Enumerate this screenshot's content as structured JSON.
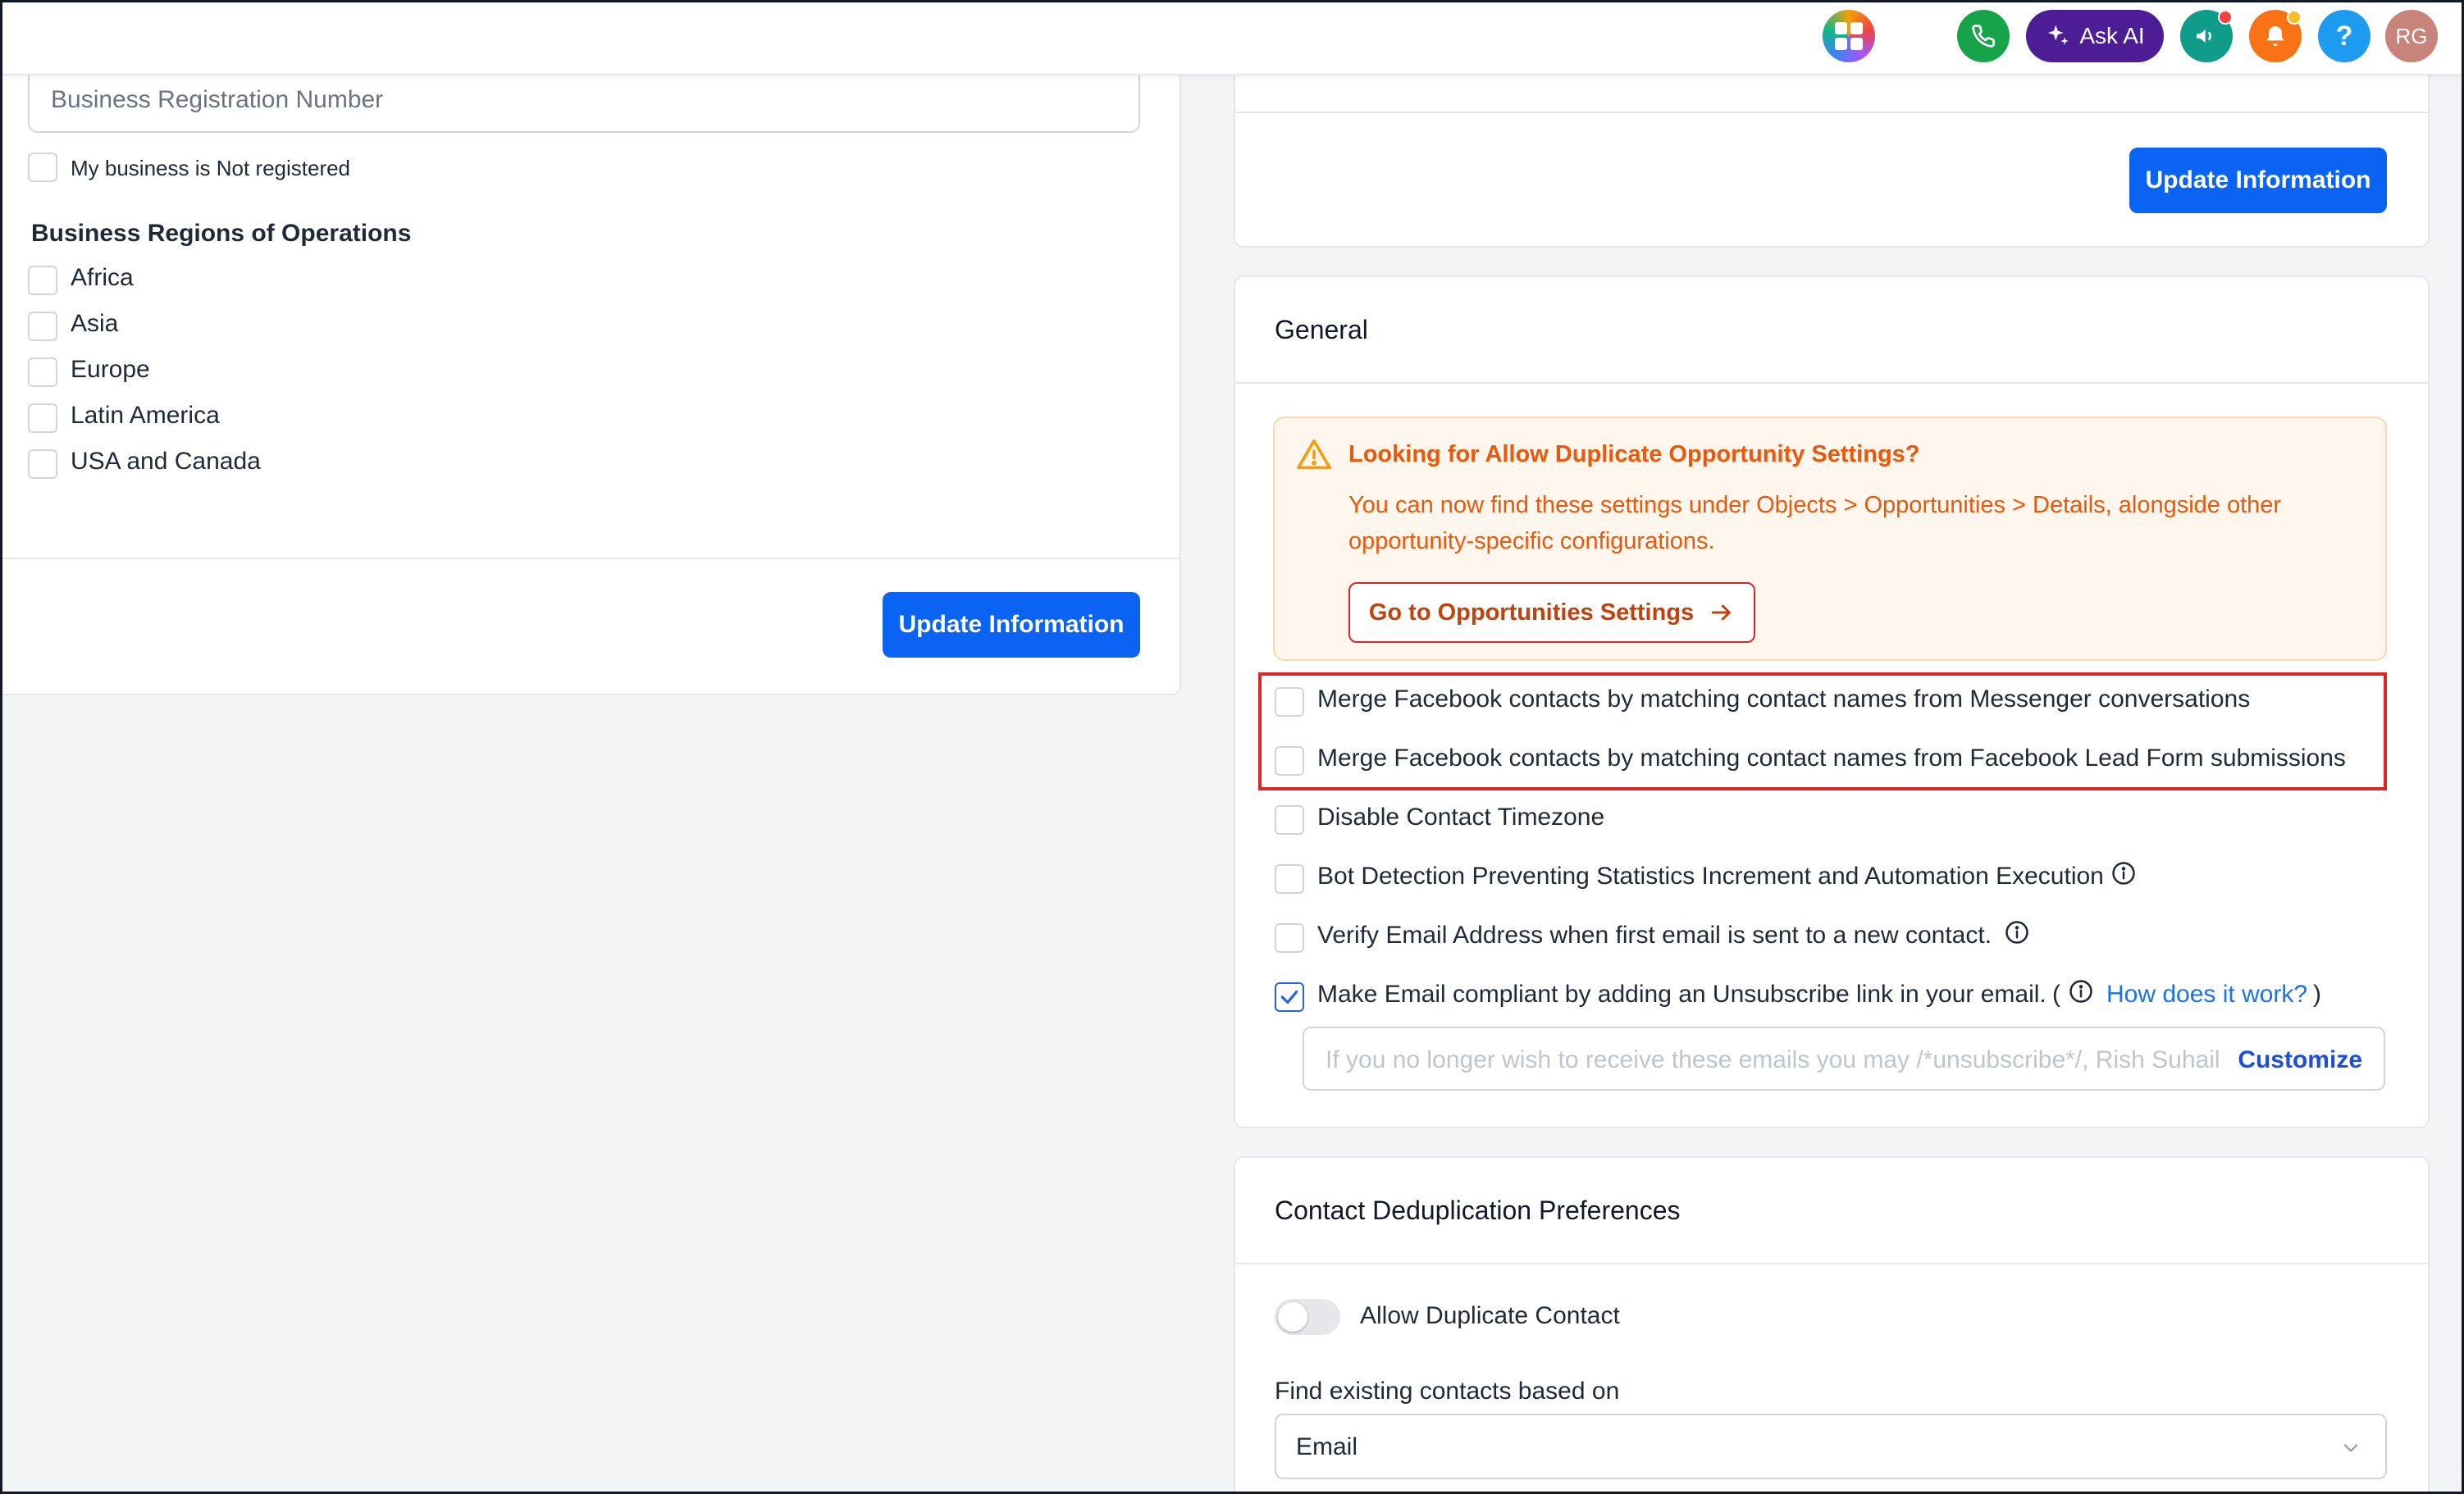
{
  "topbar": {
    "ask_ai_label": "Ask AI",
    "help_label": "?",
    "avatar_initials": "RG",
    "icons": [
      "apps-grid-icon",
      "phone-icon",
      "sparkle-icon",
      "megaphone-icon",
      "bell-icon",
      "help-icon"
    ]
  },
  "business_info": {
    "registration_placeholder": "Business Registration Number",
    "not_registered_label": "My business is Not registered",
    "regions_heading": "Business Regions of Operations",
    "regions": [
      {
        "label": "Africa",
        "checked": false
      },
      {
        "label": "Asia",
        "checked": false
      },
      {
        "label": "Europe",
        "checked": false
      },
      {
        "label": "Latin America",
        "checked": false
      },
      {
        "label": "USA and Canada",
        "checked": false
      }
    ],
    "update_button": "Update Information"
  },
  "top_right_card": {
    "update_button": "Update Information"
  },
  "general": {
    "title": "General",
    "warning": {
      "title": "Looking for Allow Duplicate Opportunity Settings?",
      "text": "You can now find these settings under Objects > Opportunities > Details, alongside other opportunity-specific configurations.",
      "button": "Go to Opportunities Settings",
      "accent_color": "#ea580c"
    },
    "options": [
      {
        "label": "Merge Facebook contacts by matching contact names from Messenger conversations",
        "checked": false
      },
      {
        "label": "Merge Facebook contacts by matching contact names from Facebook Lead Form submissions",
        "checked": false
      },
      {
        "label": "Disable Contact Timezone",
        "checked": false
      },
      {
        "label": "Bot Detection Preventing Statistics Increment and Automation Execution",
        "checked": false
      },
      {
        "label": "Verify Email Address when first email is sent to a new contact.",
        "checked": false
      },
      {
        "label": "Make Email compliant by adding an Unsubscribe link in your email.",
        "checked": true
      }
    ],
    "open_paren": "(",
    "close_paren": ")",
    "how_link": "How does it work?",
    "unsubscribe_placeholder": "If you no longer wish to receive these emails you may /*unsubscribe*/, Rish Suhail",
    "customize_label": "Customize"
  },
  "dedup": {
    "title": "Contact Deduplication Preferences",
    "allow_duplicate_label": "Allow Duplicate Contact",
    "allow_duplicate_enabled": false,
    "find_label": "Find existing contacts based on",
    "find_value": "Email"
  }
}
